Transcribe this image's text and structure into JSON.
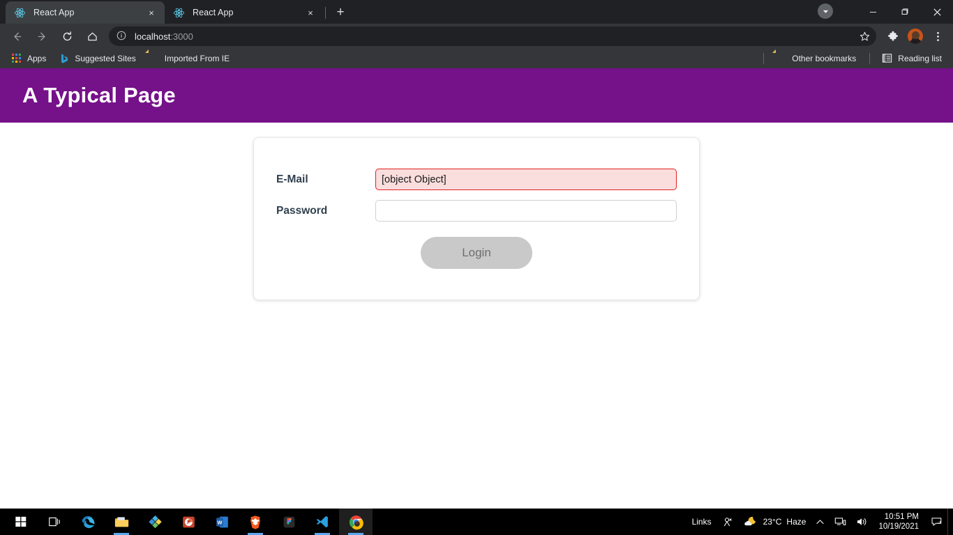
{
  "browser": {
    "tabs": [
      {
        "title": "React App",
        "favicon": "react-logo-icon",
        "active": true,
        "close_label": "×"
      },
      {
        "title": "React App",
        "favicon": "react-logo-icon",
        "active": false,
        "close_label": "×"
      }
    ],
    "new_tab_label": "+",
    "tab_search_label": "▾",
    "window_controls": {
      "minimize": "—",
      "maximize": "❐",
      "close": "✕"
    },
    "nav": {
      "back": "←",
      "forward": "→",
      "reload": "⟳",
      "home": "⌂"
    },
    "omnibox": {
      "host": "localhost",
      "port": ":3000",
      "info_icon": "site-info-icon",
      "star_icon": "bookmark-star-icon"
    },
    "toolbar_icons": {
      "extensions": "puzzle-piece-icon",
      "profile": "profile-avatar-icon",
      "menu": "three-dot-menu-icon"
    },
    "bookmarks": [
      {
        "label": "Apps",
        "icon": "apps-grid-icon"
      },
      {
        "label": "Suggested Sites",
        "icon": "bing-b-icon"
      },
      {
        "label": "Imported From IE",
        "icon": "folder-icon"
      }
    ],
    "bookmarks_right": [
      {
        "label": "Other bookmarks",
        "icon": "folder-icon"
      },
      {
        "label": "Reading list",
        "icon": "reading-list-icon"
      }
    ]
  },
  "page": {
    "header_title": "A Typical Page",
    "header_color": "#751189",
    "form": {
      "email": {
        "label": "E-Mail",
        "value": "[object Object]",
        "placeholder": "",
        "invalid": true,
        "invalid_border_color": "#e02020",
        "invalid_bg_color": "#fadddd"
      },
      "password": {
        "label": "Password",
        "value": "",
        "placeholder": "",
        "invalid": false
      },
      "submit": {
        "label": "Login",
        "disabled": true
      }
    }
  },
  "taskbar": {
    "apps": [
      {
        "name": "start-button",
        "icon": "windows-logo-icon",
        "running": false,
        "active": false
      },
      {
        "name": "task-view-button",
        "icon": "task-view-icon",
        "running": false,
        "active": false
      },
      {
        "name": "microsoft-edge",
        "icon": "edge-icon",
        "running": false,
        "active": false
      },
      {
        "name": "file-explorer",
        "icon": "file-explorer-icon",
        "running": true,
        "active": false
      },
      {
        "name": "microsoft-store",
        "icon": "microsoft-store-icon",
        "running": false,
        "active": false
      },
      {
        "name": "powerpoint",
        "icon": "powerpoint-icon",
        "running": false,
        "active": false
      },
      {
        "name": "word",
        "icon": "word-icon",
        "running": false,
        "active": false
      },
      {
        "name": "brave-browser",
        "icon": "brave-lion-icon",
        "running": true,
        "active": false
      },
      {
        "name": "figma",
        "icon": "figma-icon",
        "running": false,
        "active": false
      },
      {
        "name": "visual-studio-code",
        "icon": "vscode-icon",
        "running": true,
        "active": false
      },
      {
        "name": "google-chrome",
        "icon": "chrome-icon",
        "running": true,
        "active": true
      }
    ],
    "tray": {
      "links_label": "Links",
      "people_icon": "people-icon",
      "weather_icon": "moon-cloud-icon",
      "weather_temp": "23°C",
      "weather_condition": "Haze",
      "chevron": "⌃",
      "network_icon": "network-icon",
      "volume_icon": "volume-icon",
      "time": "10:51 PM",
      "date": "10/19/2021",
      "notification_icon": "notification-icon"
    }
  }
}
